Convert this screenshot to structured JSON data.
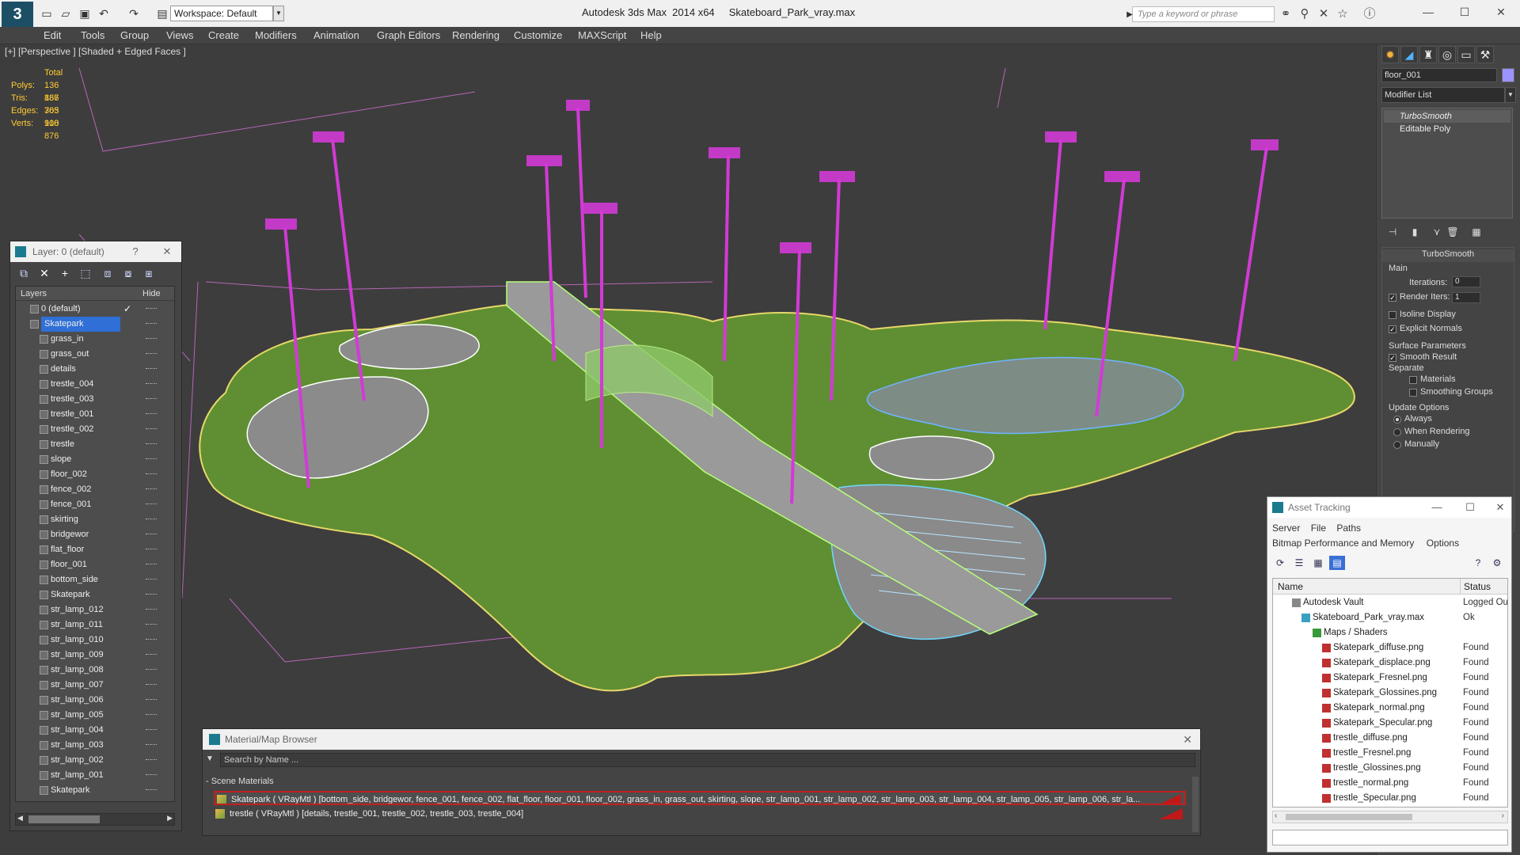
{
  "app": {
    "title": "Autodesk 3ds Max  2014 x64     Skateboard_Park_vray.max",
    "logo": "3",
    "workspace": "Workspace: Default",
    "search_placeholder": "Type a keyword or phrase"
  },
  "menu": [
    "Edit",
    "Tools",
    "Group",
    "Views",
    "Create",
    "Modifiers",
    "Animation",
    "Graph Editors",
    "Rendering",
    "Customize",
    "MAXScript",
    "Help"
  ],
  "viewport": {
    "label": "[+] [Perspective ] [Shaded + Edged Faces ]",
    "stats": {
      "total_label": "Total",
      "polys_label": "Polys:",
      "polys": "136 887",
      "tris_label": "Tris:",
      "tris": "186 705",
      "edges_label": "Edges:",
      "edges": "363 918",
      "verts_label": "Verts:",
      "verts": "100 876"
    }
  },
  "command_panel": {
    "object_name": "floor_001",
    "modifier_list": "Modifier List",
    "stack": [
      "TurboSmooth",
      "Editable Poly"
    ],
    "rollout_title": "TurboSmooth",
    "main_label": "Main",
    "iterations_label": "Iterations:",
    "iterations": "0",
    "render_iters_label": "Render Iters:",
    "render_iters": "1",
    "isoline": "Isoline Display",
    "explicit_normals": "Explicit Normals",
    "surface_params": "Surface Parameters",
    "smooth_result": "Smooth Result",
    "separate": "Separate",
    "materials": "Materials",
    "smoothing_groups": "Smoothing Groups",
    "update_options": "Update Options",
    "always": "Always",
    "when_rendering": "When Rendering",
    "manually": "Manually"
  },
  "layer_window": {
    "title": "Layer: 0 (default)",
    "help": "?",
    "col_layers": "Layers",
    "col_hide": "Hide",
    "rows": [
      "0 (default)",
      "Skatepark",
      "grass_in",
      "grass_out",
      "details",
      "trestle_004",
      "trestle_003",
      "trestle_001",
      "trestle_002",
      "trestle",
      "slope",
      "floor_002",
      "fence_002",
      "fence_001",
      "skirting",
      "bridgewor",
      "flat_floor",
      "floor_001",
      "bottom_side",
      "Skatepark",
      "str_lamp_012",
      "str_lamp_011",
      "str_lamp_010",
      "str_lamp_009",
      "str_lamp_008",
      "str_lamp_007",
      "str_lamp_006",
      "str_lamp_005",
      "str_lamp_004",
      "str_lamp_003",
      "str_lamp_002",
      "str_lamp_001",
      "Skatepark"
    ]
  },
  "material_browser": {
    "title": "Material/Map Browser",
    "search_placeholder": "Search by Name ...",
    "category": "- Scene Materials",
    "rows": [
      "Skatepark  ( VRayMtl ) [bottom_side, bridgewor, fence_001, fence_002, flat_floor, floor_001, floor_002, grass_in, grass_out, skirting, slope, str_lamp_001, str_lamp_002, str_lamp_003, str_lamp_004, str_lamp_005, str_lamp_006, str_la...",
      "trestle  ( VRayMtl ) [details, trestle_001, trestle_002, trestle_003, trestle_004]"
    ]
  },
  "asset_tracking": {
    "title": "Asset Tracking",
    "menu1": [
      "Server",
      "File",
      "Paths"
    ],
    "menu2": [
      "Bitmap Performance and Memory",
      "Options"
    ],
    "col_name": "Name",
    "col_status": "Status",
    "rows": [
      {
        "name": "Autodesk Vault",
        "status": "Logged Ou"
      },
      {
        "name": "Skateboard_Park_vray.max",
        "status": "Ok"
      },
      {
        "name": "Maps / Shaders",
        "status": ""
      },
      {
        "name": "Skatepark_diffuse.png",
        "status": "Found"
      },
      {
        "name": "Skatepark_displace.png",
        "status": "Found"
      },
      {
        "name": "Skatepark_Fresnel.png",
        "status": "Found"
      },
      {
        "name": "Skatepark_Glossines.png",
        "status": "Found"
      },
      {
        "name": "Skatepark_normal.png",
        "status": "Found"
      },
      {
        "name": "Skatepark_Specular.png",
        "status": "Found"
      },
      {
        "name": "trestle_diffuse.png",
        "status": "Found"
      },
      {
        "name": "trestle_Fresnel.png",
        "status": "Found"
      },
      {
        "name": "trestle_Glossines.png",
        "status": "Found"
      },
      {
        "name": "trestle_normal.png",
        "status": "Found"
      },
      {
        "name": "trestle_Specular.png",
        "status": "Found"
      }
    ]
  },
  "colors": {
    "accent": "#1c7a8f",
    "selection": "#2f6fd6",
    "lamp": "#d23ad6",
    "grass": "#5c8a30",
    "yellow_stat": "#ffcc33"
  }
}
